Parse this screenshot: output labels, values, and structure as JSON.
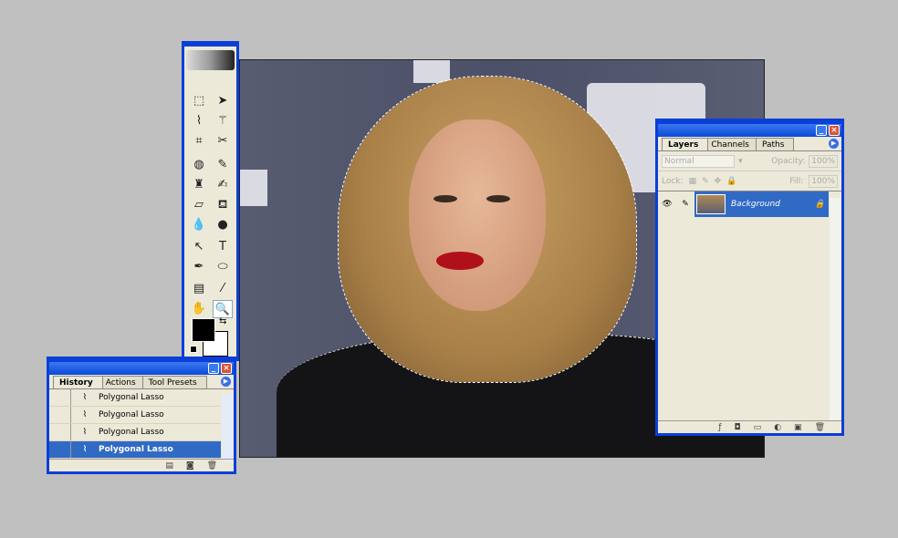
{
  "toolbox": {
    "tools": [
      "rect-marquee",
      "move",
      "polygonal-lasso",
      "magic-wand",
      "crop",
      "slice",
      "healing-brush",
      "brush",
      "clone-stamp",
      "history-brush",
      "eraser",
      "paint-bucket",
      "blur",
      "dodge",
      "path-select",
      "type",
      "pen",
      "ellipse",
      "notes",
      "eyedropper",
      "hand",
      "zoom"
    ],
    "foreground": "#000000",
    "background": "#ffffff"
  },
  "history": {
    "tabs": [
      "History",
      "Actions",
      "Tool Presets"
    ],
    "items": [
      "Polygonal Lasso",
      "Polygonal Lasso",
      "Polygonal Lasso",
      "Polygonal Lasso"
    ],
    "selected": 3
  },
  "layers": {
    "tabs": [
      "Layers",
      "Channels",
      "Paths"
    ],
    "blend_mode": "Normal",
    "opacity_label": "Opacity:",
    "opacity": "100%",
    "lock_label": "Lock:",
    "fill_label": "Fill:",
    "fill": "100%",
    "layer_name": "Background"
  },
  "colors": {
    "accent": "#316ac5",
    "frame": "#0a3fd8",
    "panel": "#ece9d8"
  }
}
